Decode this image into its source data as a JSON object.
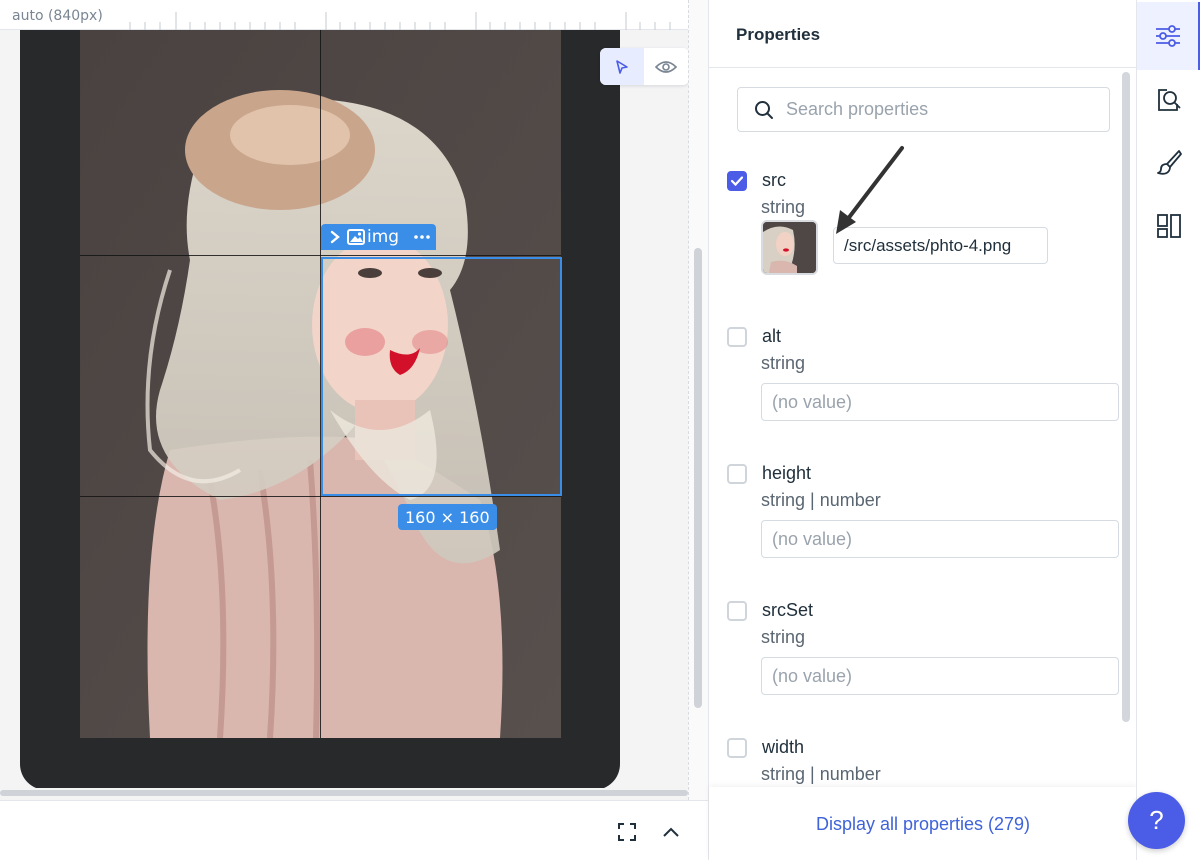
{
  "canvas": {
    "ruler_label": "auto (840px)",
    "selection": {
      "tag_label": "img",
      "size_label": "160 × 160"
    }
  },
  "panel": {
    "title": "Properties",
    "search": {
      "placeholder": "Search properties",
      "value": ""
    },
    "properties": [
      {
        "name": "src",
        "type": "string",
        "checked": true,
        "value": "/src/assets/phto-4.png"
      },
      {
        "name": "alt",
        "type": "string",
        "checked": false,
        "placeholder": "(no value)"
      },
      {
        "name": "height",
        "type": "string | number",
        "checked": false,
        "placeholder": "(no value)"
      },
      {
        "name": "srcSet",
        "type": "string",
        "checked": false,
        "placeholder": "(no value)"
      },
      {
        "name": "width",
        "type": "string | number",
        "checked": false
      }
    ],
    "footer_link": "Display all properties (279)"
  },
  "rail": {
    "items": [
      {
        "icon": "sliders-icon",
        "active": true
      },
      {
        "icon": "inspect-icon",
        "active": false
      },
      {
        "icon": "brush-icon",
        "active": false
      },
      {
        "icon": "layout-icon",
        "active": false
      }
    ],
    "help_label": "?"
  },
  "colors": {
    "accent": "#4b5ce6",
    "selection": "#3b8ee8",
    "link": "#3f63d8",
    "device": "#27292b"
  }
}
